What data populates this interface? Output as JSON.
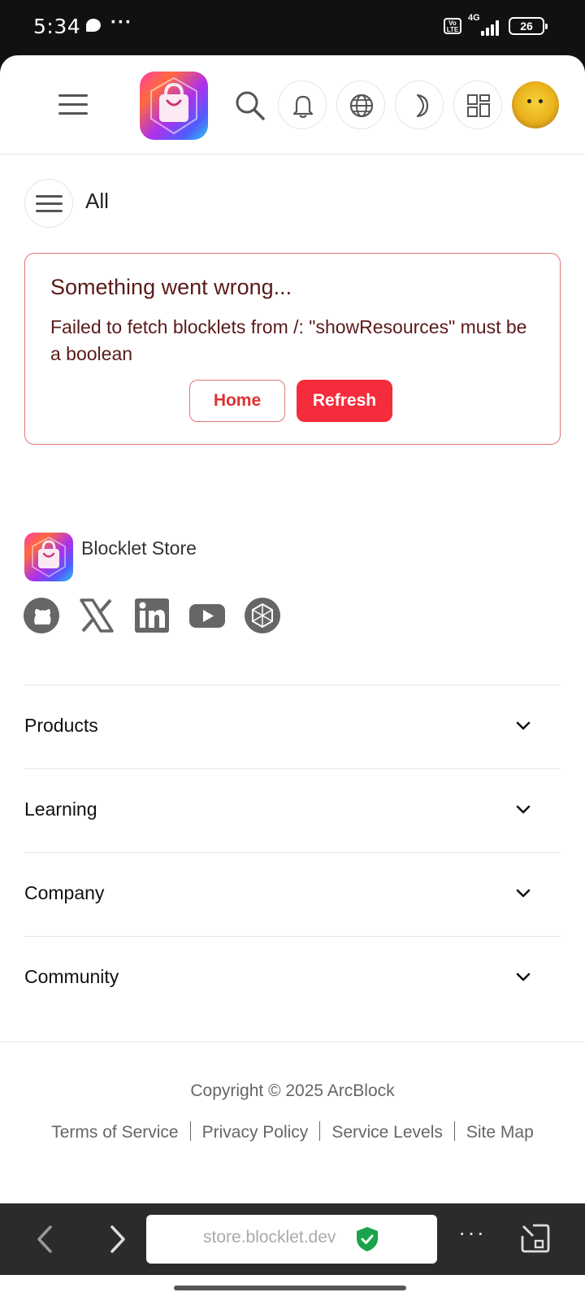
{
  "status_bar": {
    "time": "5:34",
    "dots": "···",
    "volte": "Vo LTE",
    "network": "4G",
    "battery": "26"
  },
  "header": {
    "menu_icon": "hamburger-icon",
    "logo": "blocklet-store-logo",
    "actions": [
      "search-icon",
      "bell-icon",
      "globe-icon",
      "moon-icon",
      "grid-icon"
    ],
    "avatar": "user-avatar"
  },
  "filter": {
    "label": "All"
  },
  "error": {
    "title": "Something went wrong...",
    "message": "Failed to fetch blocklets from /: \"showResources\" must be a boolean",
    "home_label": "Home",
    "refresh_label": "Refresh",
    "accent_color": "#f52c3b"
  },
  "footer": {
    "brand": "Blocklet Store",
    "social": [
      "github-icon",
      "x-icon",
      "linkedin-icon",
      "youtube-icon",
      "arcblock-icon"
    ],
    "sections": [
      {
        "label": "Products"
      },
      {
        "label": "Learning"
      },
      {
        "label": "Company"
      },
      {
        "label": "Community"
      }
    ],
    "copyright": "Copyright © 2025 ArcBlock",
    "links": [
      "Terms of Service",
      "Privacy Policy",
      "Service Levels",
      "Site Map"
    ]
  },
  "browser": {
    "url": "store.blocklet.dev",
    "secure_color": "#1aa34a"
  }
}
